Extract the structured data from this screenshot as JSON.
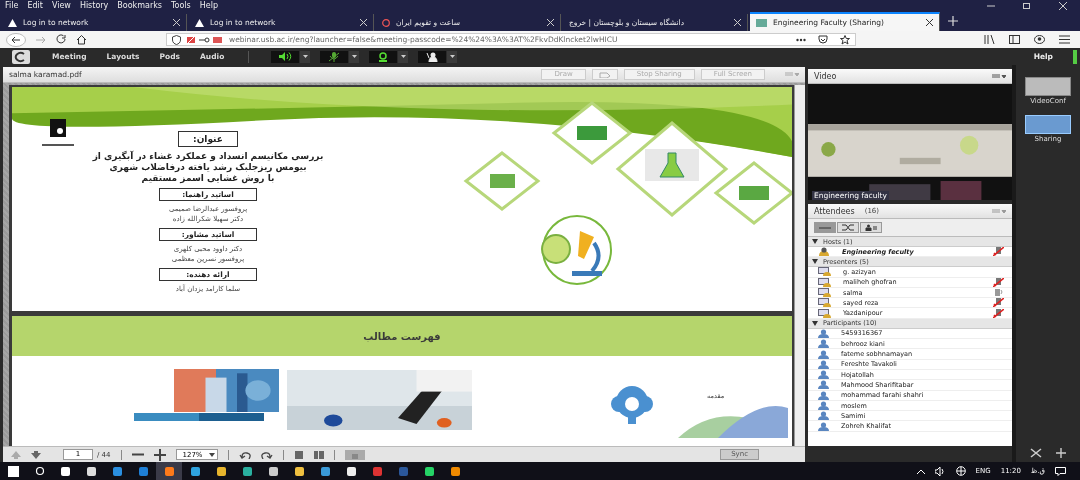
{
  "menu": [
    "File",
    "Edit",
    "View",
    "History",
    "Bookmarks",
    "Tools",
    "Help"
  ],
  "tabs": [
    {
      "label": "Log in to network",
      "kind": "warning",
      "selected": false
    },
    {
      "label": "Log in to network",
      "kind": "warning",
      "selected": false
    },
    {
      "label": "ساعت و تقویم ایران",
      "kind": "check",
      "selected": false
    },
    {
      "label": "دانشگاه سیستان و بلوچستان | خروج",
      "kind": "plain",
      "selected": false
    },
    {
      "label": "Engineering Faculty (Sharing)",
      "kind": "site",
      "selected": true
    }
  ],
  "url": "webinar.usb.ac.ir/eng?launcher=false&meeting-passcode=%24%24%3A%3AT%2FkvDdKlncket2lwHICU",
  "app_menu": [
    "Meeting",
    "Layouts",
    "Pods",
    "Audio"
  ],
  "help": "Help",
  "share_pod": {
    "title": "salma karamad.pdf",
    "buttons": [
      {
        "kind": "text",
        "label": "Draw"
      },
      {
        "kind": "icon"
      },
      {
        "kind": "text",
        "label": "Stop Sharing"
      },
      {
        "kind": "text",
        "label": "Full Screen"
      }
    ]
  },
  "slide1": {
    "heading": "عنوان:",
    "title_lines": [
      "بررسی مکانیسم انسداد و عملکرد غشاء در آبگیری از",
      "بیومس ریزجلبک رشد یافته درفاضلاب شهری",
      "با روش غشایی اسمز مستقیم"
    ],
    "sections": [
      {
        "label": "اساتید راهنما:",
        "names": [
          "پروفسور عبدالرضا صمیمی",
          "دکتر سهیلا شکرالله زاده"
        ]
      },
      {
        "label": "اساتید مشاور:",
        "names": [
          "دکتر داوود محبی کلهری",
          "پروفسور نسرین معظمی"
        ]
      },
      {
        "label": "ارائه دهنده:",
        "names": [
          "سلما کارامد یزدان آباد"
        ]
      }
    ]
  },
  "slide2": {
    "title": "فهرست مطالب",
    "caption": "مقدمه"
  },
  "pager": {
    "page": "1",
    "total": "/ 44",
    "zoom": "127%",
    "sync": "Sync"
  },
  "video": {
    "title": "Video",
    "caption": "Engineering faculty"
  },
  "attendees": {
    "title": "Attendees",
    "count": "(16)",
    "groups": [
      {
        "label": "Hosts (1)",
        "expanded": true,
        "kind": "host",
        "people": [
          {
            "name": "Engineering  feculty",
            "kind": "muted"
          }
        ]
      },
      {
        "label": "Presenters (5)",
        "expanded": true,
        "kind": "presenter",
        "people": [
          {
            "name": "g. azizyan",
            "kind": "plain"
          },
          {
            "name": "maliheh ghofran",
            "kind": "muted"
          },
          {
            "name": "salma",
            "kind": "mic"
          },
          {
            "name": "sayed reza",
            "kind": "muted"
          },
          {
            "name": "Yazdanipour",
            "kind": "muted"
          }
        ]
      },
      {
        "label": "Participants (10)",
        "expanded": true,
        "kind": "participant",
        "people": [
          {
            "name": "5459316367",
            "kind": "plain"
          },
          {
            "name": "behrooz kiani",
            "kind": "plain"
          },
          {
            "name": "fateme sobhnamayan",
            "kind": "plain"
          },
          {
            "name": "Fereshte Tavakoli",
            "kind": "plain"
          },
          {
            "name": "Hojatollah",
            "kind": "plain"
          },
          {
            "name": "Mahmood Sharifitabar",
            "kind": "plain"
          },
          {
            "name": "mohammad farahi shahri",
            "kind": "plain"
          },
          {
            "name": "moslem",
            "kind": "plain"
          },
          {
            "name": "Samimi",
            "kind": "plain"
          },
          {
            "name": "Zohreh Khalifat",
            "kind": "plain"
          }
        ]
      }
    ]
  },
  "layouts": [
    {
      "label": "VideoConf",
      "selected": false
    },
    {
      "label": "Sharing",
      "selected": true
    }
  ],
  "tray": {
    "lang": "ENG",
    "time": "11:20",
    "ampm": "ق.ظ"
  }
}
